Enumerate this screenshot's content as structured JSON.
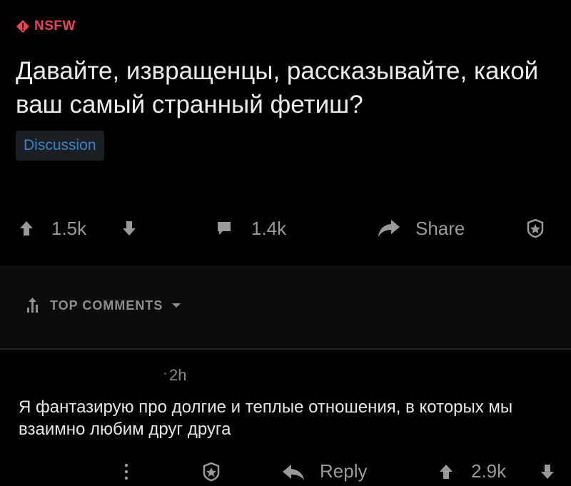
{
  "post": {
    "nsfw_label": "NSFW",
    "title": "Давайте, извращенцы, рассказывайте, какой ваш самый странный фетиш?",
    "flair": "Discussion",
    "score": "1.5k",
    "comment_count": "1.4k",
    "share_label": "Share"
  },
  "comments_header": {
    "sort_label": "TOP COMMENTS"
  },
  "comment": {
    "time": "2h",
    "body": "Я фантазирую про долгие и теплые отношения, в которых мы взаимно любим друг друга",
    "reply_label": "Reply",
    "score": "2.9k"
  },
  "colors": {
    "nsfw": "#e8435a",
    "flair_text": "#3d82c8",
    "icon": "#9a9a9a"
  }
}
